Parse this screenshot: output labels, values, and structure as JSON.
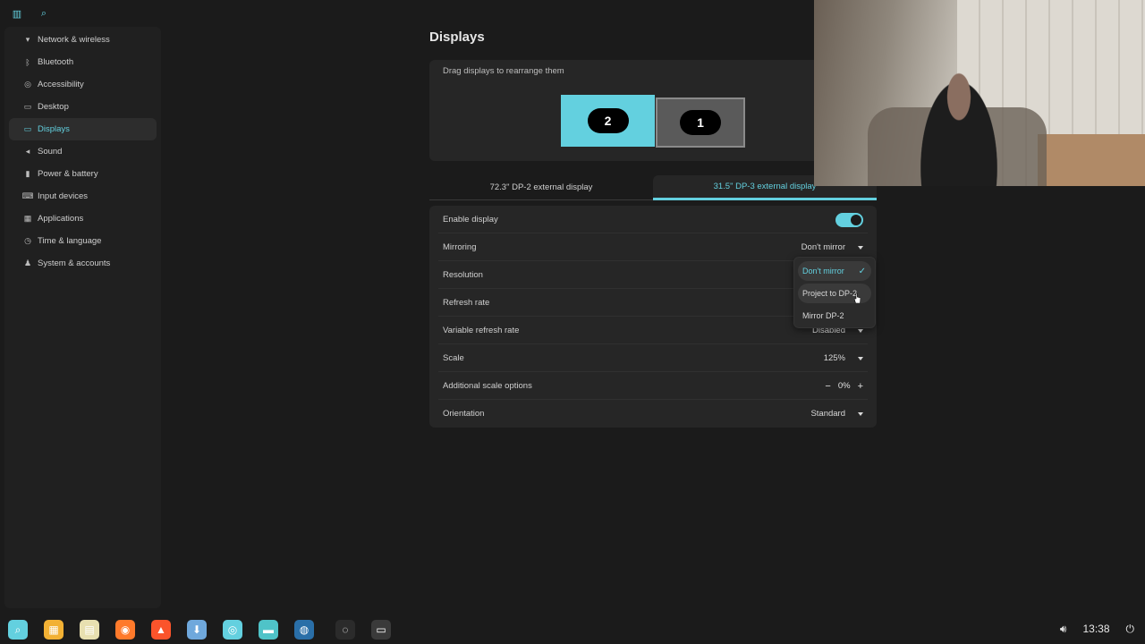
{
  "topbar": {
    "left_icon": "sidebar-toggle-icon",
    "search_icon": "search-icon"
  },
  "sidebar": {
    "items": [
      {
        "label": "Network & wireless",
        "icon": "wifi-icon",
        "glyph": "▾"
      },
      {
        "label": "Bluetooth",
        "icon": "bluetooth-icon",
        "glyph": "ᛒ"
      },
      {
        "label": "Accessibility",
        "icon": "accessibility-icon",
        "glyph": "◎"
      },
      {
        "label": "Desktop",
        "icon": "desktop-icon",
        "glyph": "▭"
      },
      {
        "label": "Displays",
        "icon": "display-icon",
        "glyph": "▭"
      },
      {
        "label": "Sound",
        "icon": "sound-icon",
        "glyph": "◂"
      },
      {
        "label": "Power & battery",
        "icon": "battery-icon",
        "glyph": "▮"
      },
      {
        "label": "Input devices",
        "icon": "keyboard-icon",
        "glyph": "⌨"
      },
      {
        "label": "Applications",
        "icon": "apps-grid-icon",
        "glyph": "▦"
      },
      {
        "label": "Time & language",
        "icon": "clock-icon",
        "glyph": "◷"
      },
      {
        "label": "System & accounts",
        "icon": "users-icon",
        "glyph": "♟"
      }
    ],
    "active": "Displays"
  },
  "page": {
    "title": "Displays"
  },
  "arrange": {
    "hint": "Drag displays to rearrange them",
    "display_a": "2",
    "display_b": "1"
  },
  "tabs": [
    {
      "label": "72.3\" DP-2 external display",
      "active": false
    },
    {
      "label": "31.5\" DP-3 external display",
      "active": true
    }
  ],
  "settings": {
    "enable_display": {
      "label": "Enable display",
      "on": true
    },
    "mirroring": {
      "label": "Mirroring",
      "value": "Don't mirror"
    },
    "resolution": {
      "label": "Resolution"
    },
    "refresh_rate": {
      "label": "Refresh rate"
    },
    "vrr": {
      "label": "Variable refresh rate",
      "value": "Disabled"
    },
    "scale": {
      "label": "Scale",
      "value": "125%"
    },
    "additional_scale": {
      "label": "Additional scale options",
      "value": "0%",
      "minus": "−",
      "plus": "+"
    },
    "orientation": {
      "label": "Orientation",
      "value": "Standard"
    }
  },
  "dropdown": {
    "options": [
      "Don't mirror",
      "Project to DP-2",
      "Mirror DP-2"
    ],
    "selected": "Don't mirror",
    "check": "✓"
  },
  "taskbar": {
    "apps": [
      {
        "name": "launcher-icon",
        "color": "#63d0df"
      },
      {
        "name": "app-grid-icon",
        "color": "#f2b134"
      },
      {
        "name": "system-monitor-icon",
        "color": "#e8e0b0"
      },
      {
        "name": "firefox-icon",
        "color": "#ff7a2b"
      },
      {
        "name": "brave-icon",
        "color": "#fb542b"
      },
      {
        "name": "store-icon",
        "color": "#6fa8dc"
      },
      {
        "name": "settings-icon",
        "color": "#63d0df"
      },
      {
        "name": "files-icon",
        "color": "#4fc3c8"
      },
      {
        "name": "steam-icon",
        "color": "#2a6fa8"
      },
      {
        "name": "obs-icon",
        "color": "#2b2b2b"
      },
      {
        "name": "terminal-icon",
        "color": "#3a3a3a"
      }
    ],
    "clock": "13:38",
    "volume_icon": "volume-icon",
    "power_icon": "power-icon"
  },
  "colors": {
    "accent": "#63d0df",
    "background": "#1b1b1b",
    "card": "#262626"
  }
}
